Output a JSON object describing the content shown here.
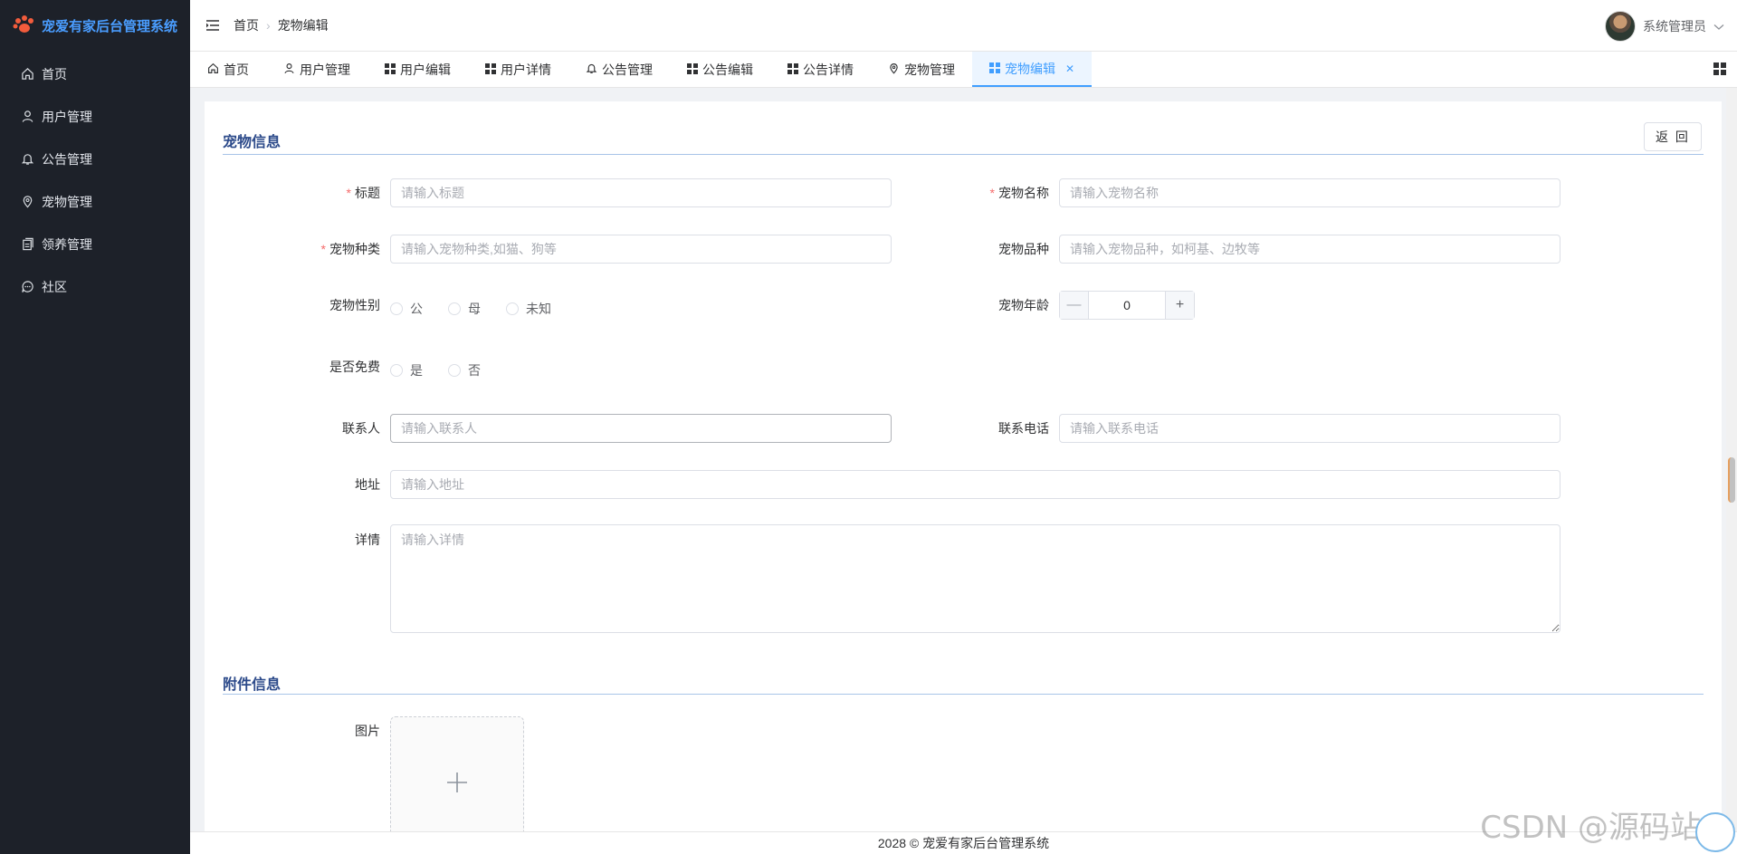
{
  "app": {
    "title": "宠爱有家后台管理系统"
  },
  "sidebar": {
    "items": [
      {
        "label": "首页",
        "icon": "home-icon"
      },
      {
        "label": "用户管理",
        "icon": "user-icon"
      },
      {
        "label": "公告管理",
        "icon": "bell-icon"
      },
      {
        "label": "宠物管理",
        "icon": "location-icon"
      },
      {
        "label": "领养管理",
        "icon": "document-icon"
      },
      {
        "label": "社区",
        "icon": "chat-icon"
      }
    ]
  },
  "header": {
    "breadcrumb": [
      "首页",
      "宠物编辑"
    ],
    "user_name": "系统管理员"
  },
  "tabs": [
    {
      "label": "首页"
    },
    {
      "label": "用户管理"
    },
    {
      "label": "用户编辑"
    },
    {
      "label": "用户详情"
    },
    {
      "label": "公告管理"
    },
    {
      "label": "公告编辑"
    },
    {
      "label": "公告详情"
    },
    {
      "label": "宠物管理"
    },
    {
      "label": "宠物编辑",
      "active": true
    }
  ],
  "form": {
    "section_pet": "宠物信息",
    "back_label": "返 回",
    "title_label": "标题",
    "title_placeholder": "请输入标题",
    "name_label": "宠物名称",
    "name_placeholder": "请输入宠物名称",
    "type_label": "宠物种类",
    "type_placeholder": "请输入宠物种类,如猫、狗等",
    "breed_label": "宠物品种",
    "breed_placeholder": "请输入宠物品种，如柯基、边牧等",
    "gender_label": "宠物性别",
    "gender_options": [
      "公",
      "母",
      "未知"
    ],
    "age_label": "宠物年龄",
    "age_value": "0",
    "free_label": "是否免费",
    "free_options": [
      "是",
      "否"
    ],
    "contact_label": "联系人",
    "contact_placeholder": "请输入联系人",
    "phone_label": "联系电话",
    "phone_placeholder": "请输入联系电话",
    "address_label": "地址",
    "address_placeholder": "请输入地址",
    "detail_label": "详情",
    "detail_placeholder": "请输入详情",
    "section_attach": "附件信息",
    "image_label": "图片"
  },
  "footer": {
    "text": "2028 © 宠爱有家后台管理系统"
  },
  "watermark": {
    "text": "CSDN @源码站"
  },
  "colors": {
    "accent": "#409eff",
    "sidebar_bg": "#1d2129",
    "brand": "#4a9dff",
    "required": "#f56c6c",
    "section_title": "#2c4a8a"
  }
}
